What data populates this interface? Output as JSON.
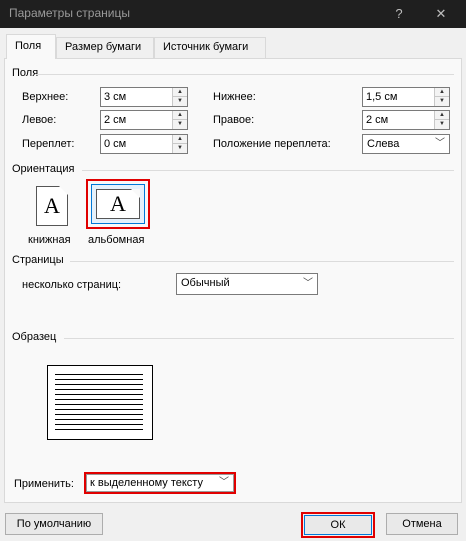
{
  "window": {
    "title": "Параметры страницы",
    "help_label": "?",
    "close_label": "✕"
  },
  "tabs": [
    {
      "label": "Поля",
      "active": true
    },
    {
      "label": "Размер бумаги",
      "active": false
    },
    {
      "label": "Источник бумаги",
      "active": false
    }
  ],
  "margins": {
    "group_label": "Поля",
    "top_label": "Верхнее:",
    "top_value": "3 см",
    "bottom_label": "Нижнее:",
    "bottom_value": "1,5 см",
    "left_label": "Левое:",
    "left_value": "2 см",
    "right_label": "Правое:",
    "right_value": "2 см",
    "gutter_label": "Переплет:",
    "gutter_value": "0 см",
    "gutter_pos_label": "Положение переплета:",
    "gutter_pos_value": "Слева"
  },
  "orientation": {
    "group_label": "Ориентация",
    "portrait_label": "книжная",
    "landscape_label": "альбомная",
    "glyph": "A",
    "selected": "landscape",
    "highlight_color": "#e00000",
    "selected_frame_color": "#0078d7"
  },
  "pages": {
    "group_label": "Страницы",
    "multiple_label": "несколько страниц:",
    "multiple_value": "Обычный"
  },
  "preview": {
    "group_label": "Образец"
  },
  "apply": {
    "label": "Применить:",
    "value": "к выделенному тексту"
  },
  "buttons": {
    "default_label": "По умолчанию",
    "ok_label": "ОК",
    "cancel_label": "Отмена"
  }
}
